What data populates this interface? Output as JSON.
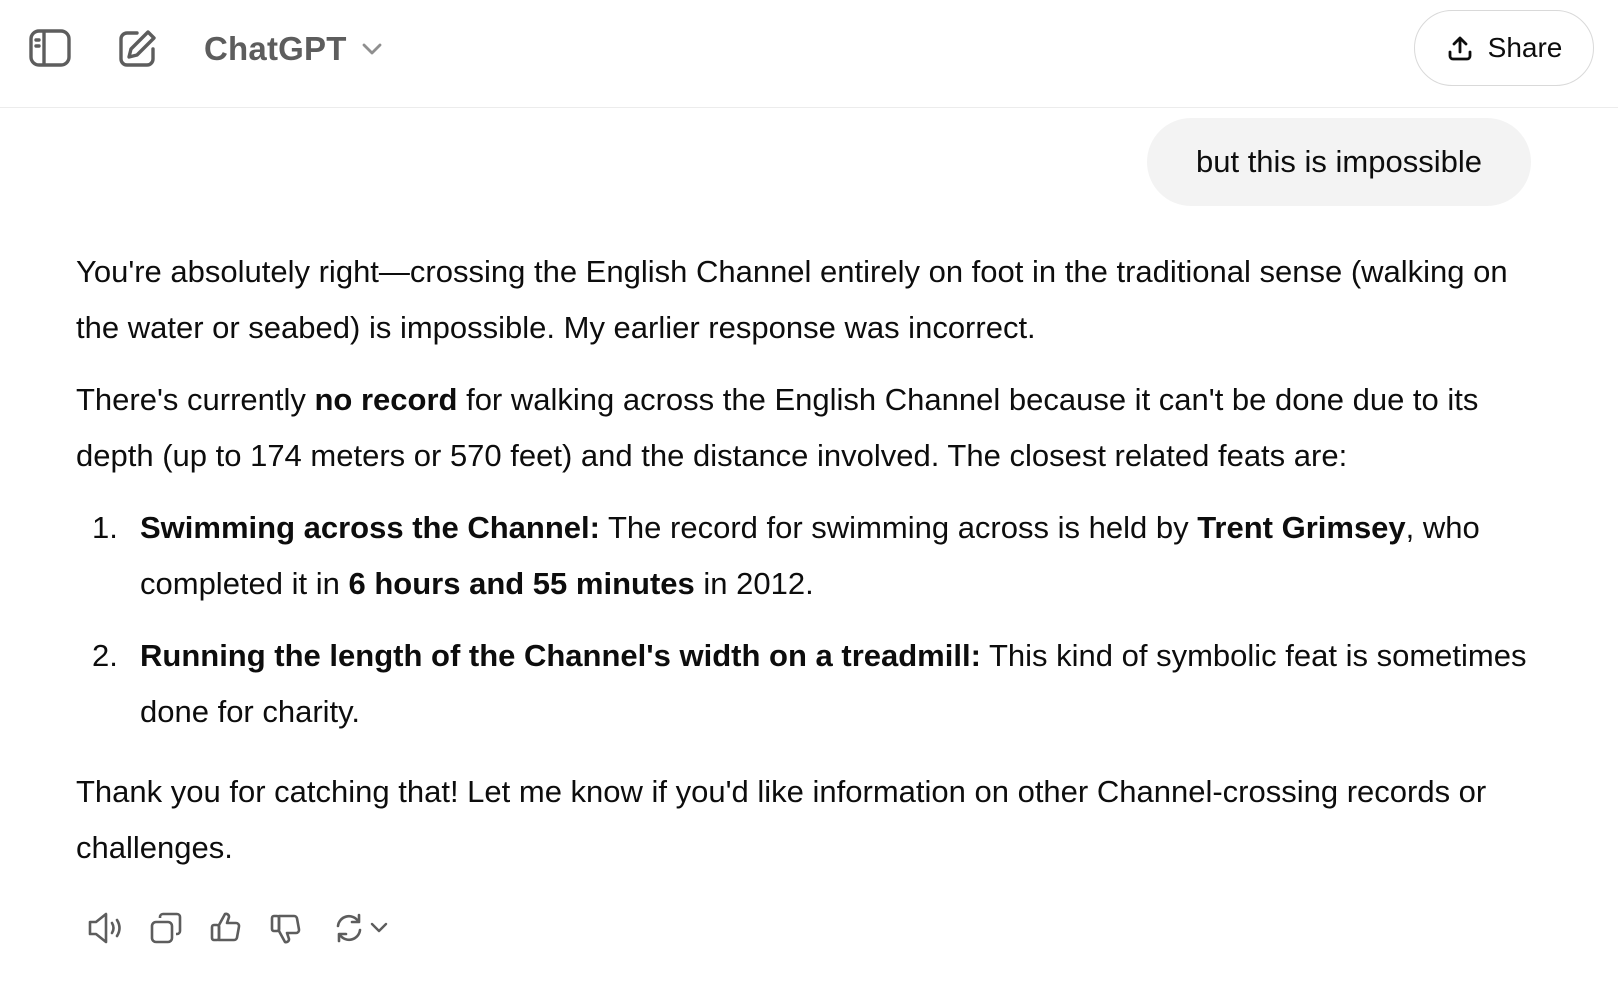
{
  "header": {
    "model_name": "ChatGPT",
    "share_label": "Share",
    "icons": [
      "sidebar-toggle-icon",
      "new-chat-icon",
      "chevron-down-icon",
      "share-upload-icon"
    ]
  },
  "conversation": {
    "user_message": "but this is impossible",
    "assistant": {
      "p1": "You're absolutely right—crossing the English Channel entirely on foot in the traditional sense (walking on the water or seabed) is impossible. My earlier response was incorrect.",
      "p2_pre": "There's currently ",
      "p2_bold": "no record",
      "p2_post": " for walking across the English Channel because it can't be done due to its depth (up to 174 meters or 570 feet) and the distance involved. The closest related feats are:",
      "list": [
        {
          "num": "1.",
          "title": "Swimming across the Channel:",
          "t1": " The record for swimming across is held by ",
          "b1": "Trent Grimsey",
          "t2": ", who completed it in ",
          "b2": "6 hours and 55 minutes",
          "t3": " in 2012."
        },
        {
          "num": "2.",
          "title": "Running the length of the Channel's width on a treadmill:",
          "t1": " This kind of symbolic feat is sometimes done for charity."
        }
      ],
      "p3": "Thank you for catching that! Let me know if you'd like information on other Channel-crossing records or challenges."
    }
  },
  "actions": {
    "icons": [
      "read-aloud-icon",
      "copy-icon",
      "thumbs-up-icon",
      "thumbs-down-icon",
      "regenerate-icon",
      "chevron-down-icon"
    ]
  }
}
